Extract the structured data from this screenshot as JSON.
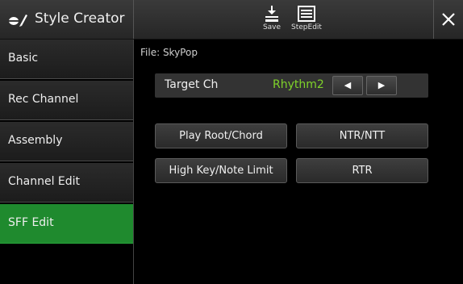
{
  "header": {
    "title": "Style Creator",
    "save_label": "Save",
    "stepedit_label": "StepEdit",
    "app_icon": "style-creator-icon",
    "close_icon": "close-icon"
  },
  "sidebar": {
    "items": [
      {
        "label": "Basic",
        "active": false
      },
      {
        "label": "Rec Channel",
        "active": false
      },
      {
        "label": "Assembly",
        "active": false
      },
      {
        "label": "Channel Edit",
        "active": false
      },
      {
        "label": "SFF Edit",
        "active": true
      }
    ]
  },
  "main": {
    "file_label": "File: SkyPop",
    "target": {
      "label": "Target Ch",
      "value": "Rhythm2",
      "prev_symbol": "◀",
      "next_symbol": "▶"
    },
    "buttons": {
      "play_root_chord": "Play Root/Chord",
      "ntr_ntt": "NTR/NTT",
      "high_key_note_limit": "High Key/Note Limit",
      "rtr": "RTR"
    }
  },
  "colors": {
    "accent_green": "#1f8a2e",
    "value_green": "#7fd32a"
  }
}
